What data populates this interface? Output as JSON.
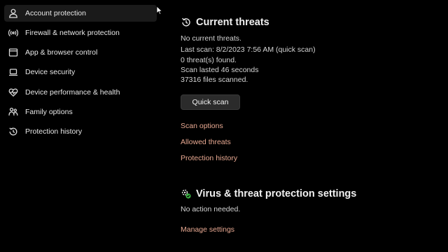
{
  "sidebar": {
    "items": [
      {
        "label": "Account protection",
        "icon": "person-icon",
        "selected": true
      },
      {
        "label": "Firewall & network protection",
        "icon": "antenna-icon",
        "selected": false
      },
      {
        "label": "App & browser control",
        "icon": "browser-window-icon",
        "selected": false
      },
      {
        "label": "Device security",
        "icon": "laptop-icon",
        "selected": false
      },
      {
        "label": "Device performance & health",
        "icon": "heart-pulse-icon",
        "selected": false
      },
      {
        "label": "Family options",
        "icon": "family-icon",
        "selected": false
      },
      {
        "label": "Protection history",
        "icon": "history-icon",
        "selected": false
      }
    ]
  },
  "current_threats": {
    "title": "Current threats",
    "icon": "scan-refresh-icon",
    "status": "No current threats.",
    "last_scan": "Last scan: 8/2/2023 7:56 AM (quick scan)",
    "threats_found": "0 threat(s) found.",
    "scan_duration": "Scan lasted 46 seconds",
    "files_scanned": "37316 files scanned.",
    "quick_scan_label": "Quick scan",
    "links": [
      "Scan options",
      "Allowed threats",
      "Protection history"
    ]
  },
  "settings": {
    "title": "Virus & threat protection settings",
    "icon": "settings-gear-shield-icon",
    "status": "No action needed.",
    "link": "Manage settings"
  },
  "colors": {
    "background": "#000000",
    "link": "#e8a992",
    "selected_item": "#1a1a1a",
    "button": "#2b2b2b",
    "status_green": "#3cb043"
  }
}
